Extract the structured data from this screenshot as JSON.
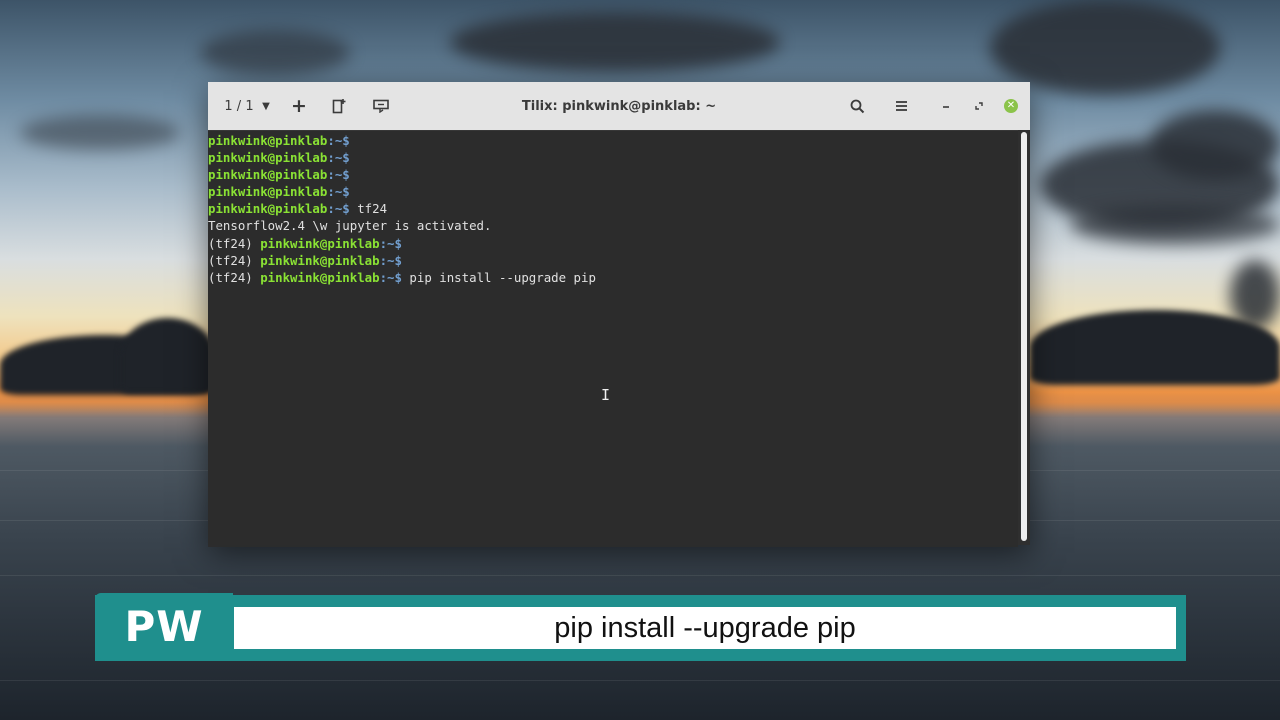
{
  "titlebar": {
    "session_label": "1 / 1",
    "window_title": "Tilix: pinkwink@pinklab: ~"
  },
  "terminal": {
    "lines": [
      {
        "prefix": "",
        "user": "pinkwink@pinklab",
        "path": ":~$",
        "command": ""
      },
      {
        "prefix": "",
        "user": "pinkwink@pinklab",
        "path": ":~$",
        "command": ""
      },
      {
        "prefix": "",
        "user": "pinkwink@pinklab",
        "path": ":~$",
        "command": ""
      },
      {
        "prefix": "",
        "user": "pinkwink@pinklab",
        "path": ":~$",
        "command": ""
      },
      {
        "prefix": "",
        "user": "pinkwink@pinklab",
        "path": ":~$",
        "command": " tf24"
      },
      {
        "output": "Tensorflow2.4 \\w jupyter is activated."
      },
      {
        "prefix": "(tf24) ",
        "user": "pinkwink@pinklab",
        "path": ":~$",
        "command": ""
      },
      {
        "prefix": "(tf24) ",
        "user": "pinkwink@pinklab",
        "path": ":~$",
        "command": ""
      },
      {
        "prefix": "(tf24) ",
        "user": "pinkwink@pinklab",
        "path": ":~$",
        "command": " pip install --upgrade pip"
      }
    ]
  },
  "banner": {
    "logo": "PW",
    "caption": "pip install --upgrade pip"
  },
  "colors": {
    "prompt_user": "#8ae234",
    "prompt_path": "#729fcf",
    "banner_teal": "#1f8f8d"
  },
  "icons": {
    "add": "plus-icon",
    "split": "split-terminal-icon",
    "bookmark": "bookmark-icon",
    "search": "search-icon",
    "menu": "hamburger-menu-icon",
    "close": "close-icon"
  }
}
